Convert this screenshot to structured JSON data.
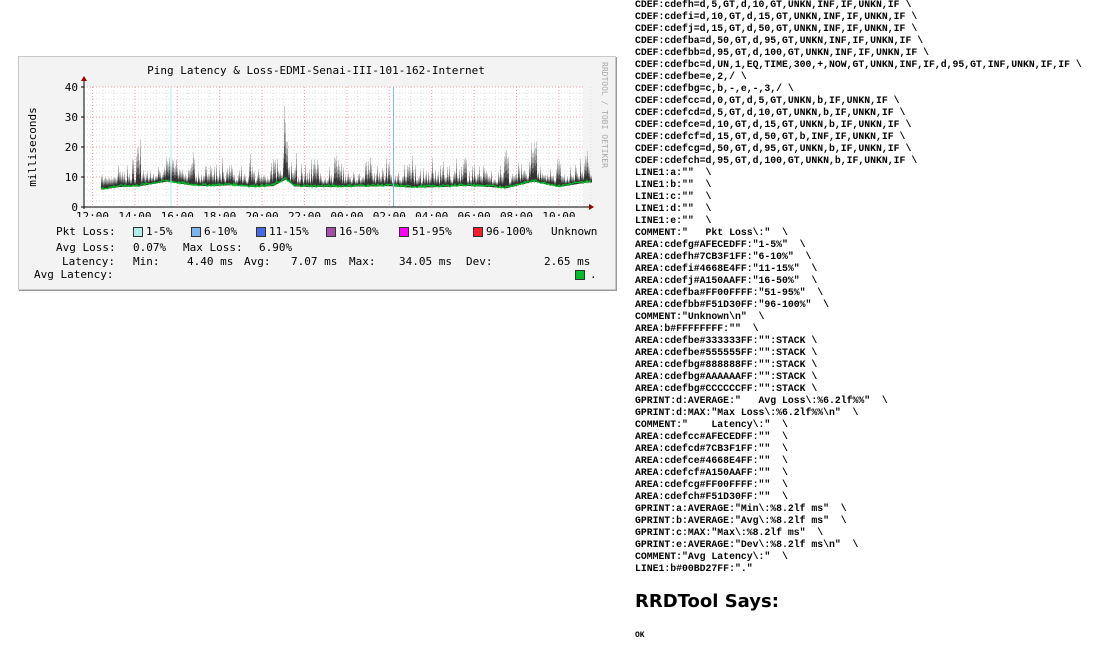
{
  "graph": {
    "title": "Ping Latency & Loss-EDMI-Senai-III-101-162-Internet",
    "watermark": "RRDTOOL / TOBI OETIKER",
    "legend": {
      "pkt_loss_label": "Pkt Loss:",
      "buckets": [
        {
          "label": "1-5%",
          "color": "#AFECED"
        },
        {
          "label": "6-10%",
          "color": "#7CB3F1"
        },
        {
          "label": "11-15%",
          "color": "#4668E4"
        },
        {
          "label": "16-50%",
          "color": "#A150AA"
        },
        {
          "label": "51-95%",
          "color": "#FF00FF"
        },
        {
          "label": "96-100%",
          "color": "#F51D30"
        }
      ],
      "unknown_label": "Unknown",
      "avg_loss_label": "Avg Loss:",
      "avg_loss_value": "0.07%",
      "max_loss_label": "Max Loss:",
      "max_loss_value": "6.90%",
      "latency_label": "Latency:",
      "min_label": "Min:",
      "min_value": "4.40 ms",
      "avg_label": "Avg:",
      "avg_value": "7.07 ms",
      "max_label": "Max:",
      "max_value": "34.05 ms",
      "dev_label": "Dev:",
      "dev_value": "2.65 ms",
      "avg_latency_label": "Avg Latency:",
      "avg_latency_color": "#00BD27",
      "avg_latency_mark": "."
    }
  },
  "chart_data": {
    "type": "area",
    "title": "Ping Latency & Loss-EDMI-Senai-III-101-162-Internet",
    "ylabel": "milliseconds",
    "xlabel": "",
    "ylim": [
      0,
      40
    ],
    "yticks": [
      "0",
      "10",
      "20",
      "30",
      "40"
    ],
    "xticks": [
      "12:00",
      "14:00",
      "16:00",
      "18:00",
      "20:00",
      "22:00",
      "00:00",
      "02:00",
      "04:00",
      "06:00",
      "08:00",
      "10:00"
    ],
    "x_hours": [
      0.5,
      1.25,
      2.15,
      3.5,
      3.75,
      4.7,
      5.5,
      6.5,
      7.5,
      8.5,
      9.1,
      9.5,
      10.5,
      11.5,
      13,
      14,
      15,
      16.5,
      17.5,
      18.5,
      19.5,
      20.8,
      22,
      23.3
    ],
    "series": [
      {
        "name": "Avg Latency",
        "color": "#00BD27",
        "values": [
          6.2,
          7,
          7.2,
          8.8,
          8.5,
          7.5,
          7.3,
          7.6,
          7,
          7.3,
          9.5,
          7.2,
          7,
          7,
          7.2,
          7.3,
          6.8,
          7,
          7.4,
          7.1,
          6.6,
          8.8,
          7,
          8.5
        ]
      },
      {
        "name": "Max Latency envelope",
        "color": "#333333",
        "values": [
          12.5,
          15,
          23,
          17,
          16,
          19,
          15,
          17,
          18,
          16,
          34,
          18,
          17,
          18,
          17,
          15,
          18,
          17,
          17,
          14,
          21,
          22,
          16,
          19.5
        ]
      }
    ],
    "markers": [
      {
        "hour": 3.7,
        "color": "#AFECED"
      },
      {
        "hour": 14.2,
        "color": "#7CB3F1"
      }
    ],
    "grid": true
  },
  "code_lines": [
    "CDEF:cdefh=d,5,GT,d,10,GT,UNKN,INF,IF,UNKN,IF \\",
    "CDEF:cdefi=d,10,GT,d,15,GT,UNKN,INF,IF,UNKN,IF \\",
    "CDEF:cdefj=d,15,GT,d,50,GT,UNKN,INF,IF,UNKN,IF \\",
    "CDEF:cdefba=d,50,GT,d,95,GT,UNKN,INF,IF,UNKN,IF \\",
    "CDEF:cdefbb=d,95,GT,d,100,GT,UNKN,INF,IF,UNKN,IF \\",
    "CDEF:cdefbc=d,UN,1,EQ,TIME,300,+,NOW,GT,UNKN,INF,IF,d,95,GT,INF,UNKN,IF,IF \\",
    "CDEF:cdefbe=e,2,/ \\",
    "CDEF:cdefbg=c,b,-,e,-,3,/ \\",
    "CDEF:cdefcc=d,0,GT,d,5,GT,UNKN,b,IF,UNKN,IF \\",
    "CDEF:cdefcd=d,5,GT,d,10,GT,UNKN,b,IF,UNKN,IF \\",
    "CDEF:cdefce=d,10,GT,d,15,GT,UNKN,b,IF,UNKN,IF \\",
    "CDEF:cdefcf=d,15,GT,d,50,GT,b,INF,IF,UNKN,IF \\",
    "CDEF:cdefcg=d,50,GT,d,95,GT,UNKN,b,IF,UNKN,IF \\",
    "CDEF:cdefch=d,95,GT,d,100,GT,UNKN,b,IF,UNKN,IF \\",
    "LINE1:a:\"\"  \\",
    "LINE1:b:\"\"  \\",
    "LINE1:c:\"\"  \\",
    "LINE1:d:\"\"  \\",
    "LINE1:e:\"\"  \\",
    "COMMENT:\"   Pkt Loss\\:\"  \\",
    "AREA:cdefg#AFECEDFF:\"1-5%\"  \\",
    "AREA:cdefh#7CB3F1FF:\"6-10%\"  \\",
    "AREA:cdefi#4668E4FF:\"11-15%\"  \\",
    "AREA:cdefj#A150AAFF:\"16-50%\"  \\",
    "AREA:cdefba#FF00FFFF:\"51-95%\"  \\",
    "AREA:cdefbb#F51D30FF:\"96-100%\"  \\",
    "COMMENT:\"Unknown\\n\"  \\",
    "AREA:b#FFFFFFFF:\"\"  \\",
    "AREA:cdefbe#333333FF:\"\":STACK \\",
    "AREA:cdefbe#555555FF:\"\":STACK \\",
    "AREA:cdefbg#888888FF:\"\":STACK \\",
    "AREA:cdefbg#AAAAAAFF:\"\":STACK \\",
    "AREA:cdefbg#CCCCCCFF:\"\":STACK \\",
    "GPRINT:d:AVERAGE:\"   Avg Loss\\:%6.2lf%%\"  \\",
    "GPRINT:d:MAX:\"Max Loss\\:%6.2lf%%\\n\"  \\",
    "COMMENT:\"    Latency\\:\"  \\",
    "AREA:cdefcc#AFECEDFF:\"\"  \\",
    "AREA:cdefcd#7CB3F1FF:\"\"  \\",
    "AREA:cdefce#4668E4FF:\"\"  \\",
    "AREA:cdefcf#A150AAFF:\"\"  \\",
    "AREA:cdefcg#FF00FFFF:\"\"  \\",
    "AREA:cdefch#F51D30FF:\"\"  \\",
    "GPRINT:a:AVERAGE:\"Min\\:%8.2lf ms\"  \\",
    "GPRINT:b:AVERAGE:\"Avg\\:%8.2lf ms\"  \\",
    "GPRINT:c:MAX:\"Max\\:%8.2lf ms\"  \\",
    "GPRINT:e:AVERAGE:\"Dev\\:%8.2lf ms\\n\"  \\",
    "COMMENT:\"Avg Latency\\:\"  \\",
    "LINE1:b#00BD27FF:\".\""
  ],
  "result": {
    "heading": "RRDTool Says:",
    "message": "OK"
  }
}
